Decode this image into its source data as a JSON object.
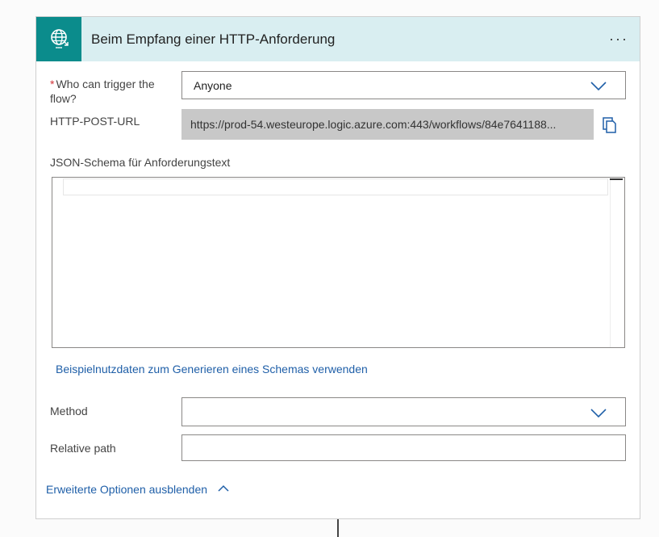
{
  "trigger": {
    "title": "Beim Empfang einer HTTP-Anforderung",
    "icon": "globe-request-icon",
    "menu_icon": "more-options-icon",
    "accent_color": "#0b8c8c",
    "header_bg": "#d9eef1"
  },
  "fields": {
    "who_can_trigger": {
      "required_mark": "*",
      "label_line1": "Who can trigger the",
      "label_line2": "flow?",
      "value": "Anyone"
    },
    "http_post_url": {
      "label": "HTTP-POST-URL",
      "value": "https://prod-54.westeurope.logic.azure.com:443/workflows/84e7641188..."
    },
    "json_schema": {
      "label": "JSON-Schema für Anforderungstext",
      "value": ""
    },
    "generate_schema_link": "Beispielnutzdaten zum Generieren eines Schemas verwenden",
    "method": {
      "label": "Method",
      "value": ""
    },
    "relative_path": {
      "label": "Relative path",
      "value": ""
    }
  },
  "advanced_options": {
    "label": "Erweiterte Optionen ausblenden",
    "icon": "chevron-up-icon"
  }
}
